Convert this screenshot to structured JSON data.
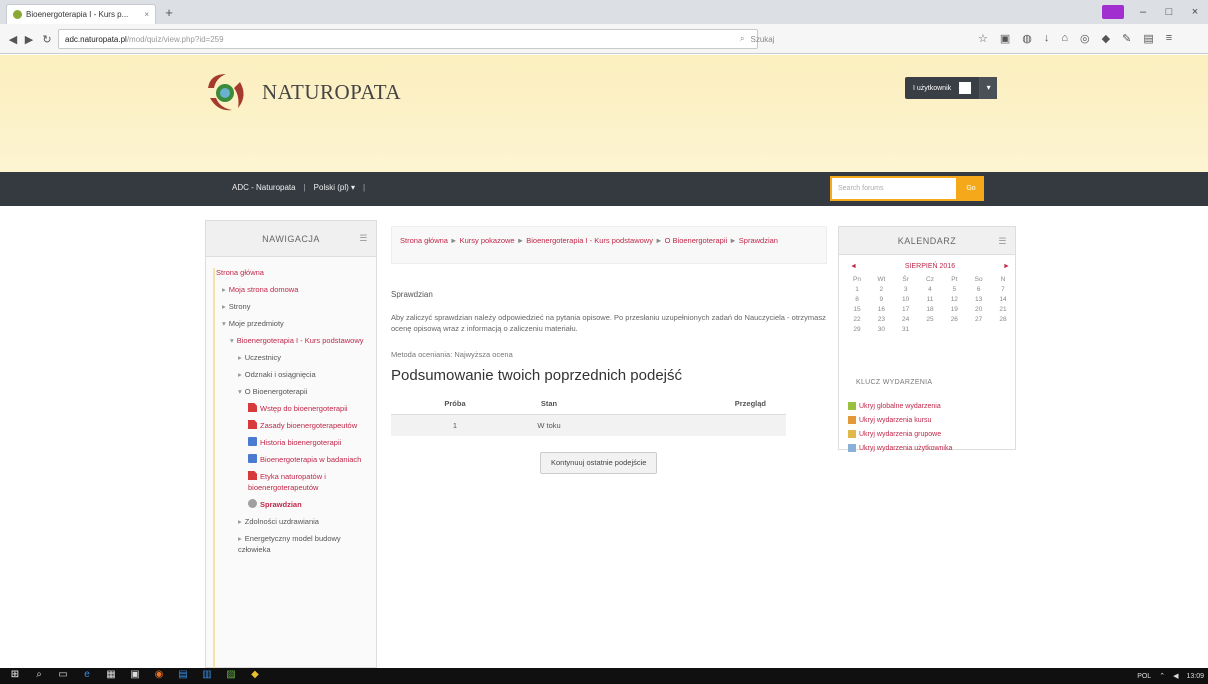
{
  "browser": {
    "tab_title": "Bioenergoterapia I - Kurs p...",
    "tab_close": "×",
    "new_tab": "+",
    "url_host": "adc.naturopata.pl",
    "url_path": "/mod/quiz/view.php?id=259",
    "search_placeholder": "Szukaj",
    "window_min": "–",
    "window_max": "□",
    "window_close": "×"
  },
  "site": {
    "brand": "NATUROPATA",
    "user_menu": "I użytkownik",
    "nav_links": [
      "ADC - Naturopata",
      "Polski (pl) ▾"
    ],
    "nav_sep": "|",
    "search_placeholder": "Search forums",
    "search_button": "Go"
  },
  "navigation": {
    "title": "NAWIGACJA",
    "items": [
      {
        "label": "Strona główna"
      },
      {
        "label": "Moja strona domowa"
      },
      {
        "label": "Strony"
      },
      {
        "label": "Moje przedmioty"
      },
      {
        "label": "Bioenergoterapia I - Kurs podstawowy"
      },
      {
        "label": "Uczestnicy"
      },
      {
        "label": "Odznaki i osiągnięcia"
      },
      {
        "label": "O Bioenergoterapii"
      },
      {
        "label": "Wstęp do bioenergoterapii"
      },
      {
        "label": "Zasady bioenergoterapeutów"
      },
      {
        "label": "Historia bioenergoterapii"
      },
      {
        "label": "Bioenergoterapia w badaniach"
      },
      {
        "label": "Etyka naturopatów i bioenergoterapeutów"
      },
      {
        "label": "Sprawdzian"
      },
      {
        "label": "Zdolności uzdrawiania"
      },
      {
        "label": "Energetyczny model budowy człowieka"
      }
    ]
  },
  "main": {
    "breadcrumb": [
      "Strona główna",
      "Kursy pokazowe",
      "Bioenergoterapia I - Kurs podstawowy",
      "O Bioenergoterapii",
      "Sprawdzian"
    ],
    "crumb_sep": "►",
    "activity_title": "Sprawdzian",
    "intro": "Aby zaliczyć sprawdzian należy odpowiedzieć na pytania opisowe. Po przesłaniu uzupełnionych zadań do Nauczyciela - otrzymasz ocenę opisową wraz z informacją o zaliczeniu materiału.",
    "grading": "Metoda oceniania: Najwyższa ocena",
    "summary_heading": "Podsumowanie twoich poprzednich podejść",
    "table_headers": [
      "Próba",
      "Stan",
      "Przegląd"
    ],
    "table_rows": [
      {
        "attempt": "1",
        "state": "W toku",
        "review": ""
      }
    ],
    "retry_button": "Kontynuuj ostatnie podejście"
  },
  "calendar": {
    "title": "KALENDARZ",
    "prev": "◄",
    "next": "►",
    "month": "SIERPIEŃ 2016",
    "weekdays": [
      "Pn",
      "Wt",
      "Śr",
      "Cz",
      "Pt",
      "So",
      "N"
    ],
    "weeks": [
      [
        "1",
        "2",
        "3",
        "4",
        "5",
        "6",
        "7"
      ],
      [
        "8",
        "9",
        "10",
        "11",
        "12",
        "13",
        "14"
      ],
      [
        "15",
        "16",
        "17",
        "18",
        "19",
        "20",
        "21"
      ],
      [
        "22",
        "23",
        "24",
        "25",
        "26",
        "27",
        "28"
      ],
      [
        "29",
        "30",
        "31",
        "",
        "",
        "",
        ""
      ]
    ],
    "key_title": "KLUCZ WYDARZENIA",
    "keys": [
      {
        "label": "Ukryj globalne wydarzenia",
        "color": "#9ac13d"
      },
      {
        "label": "Ukryj wydarzenia kursu",
        "color": "#e3983a"
      },
      {
        "label": "Ukryj wydarzenia grupowe",
        "color": "#e0b94a"
      },
      {
        "label": "Ukryj wydarzenia użytkownika",
        "color": "#8ab0d8"
      }
    ]
  },
  "taskbar": {
    "lang": "POL",
    "time": "13:09"
  },
  "colors": {
    "accent": "#c0284a",
    "header_bg": "#fcf1c4",
    "nav_bg": "#353a40",
    "search_orange": "#f5a81a"
  }
}
